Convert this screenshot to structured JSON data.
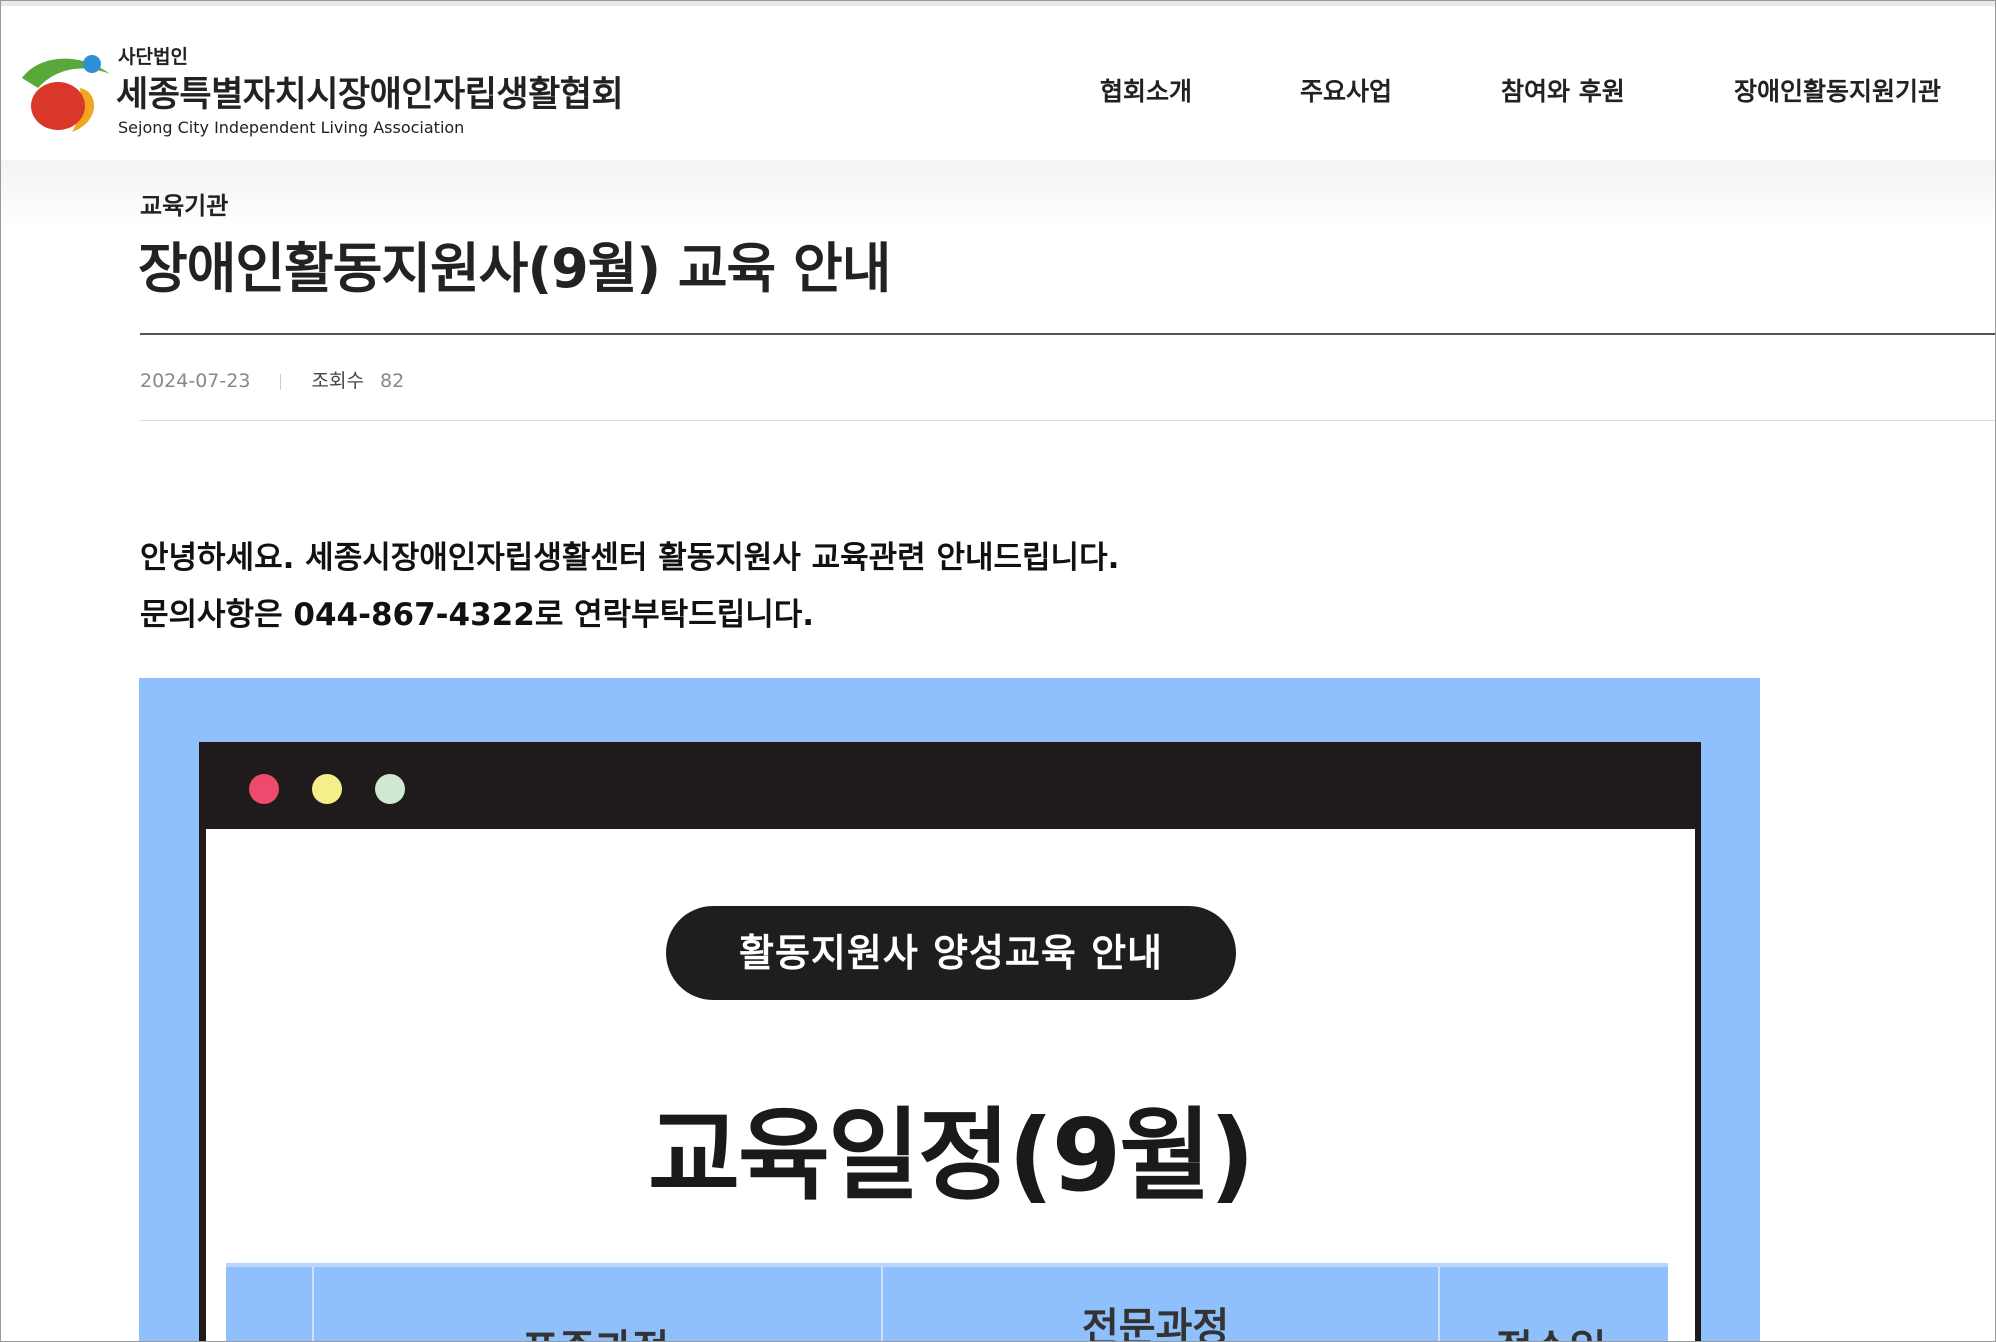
{
  "logo": {
    "subtitle": "사단법인",
    "name": "세종특별자치시장애인자립생활협회",
    "english_name": "Sejong City Independent Living Association"
  },
  "nav": {
    "items": [
      {
        "label": "협회소개"
      },
      {
        "label": "주요사업"
      },
      {
        "label": "참여와 후원"
      },
      {
        "label": "장애인활동지원기관"
      }
    ]
  },
  "post": {
    "category": "교육기관",
    "title": "장애인활동지원사(9월) 교육 안내",
    "date": "2024-07-23",
    "views_label": "조회수",
    "views": "82",
    "body_lines": [
      "안녕하세요. 세종시장애인자립생활센터 활동지원사 교육관련 안내드립니다.",
      "문의사항은 044-867-4322로 연락부탁드립니다."
    ]
  },
  "poster": {
    "pill_text": "활동지원사 양성교육 안내",
    "heading": "교육일정(9월)",
    "table_headers": [
      "표준과정",
      "전문과정",
      "접수일"
    ],
    "colors": {
      "background": "#90c0fc",
      "window": "#1f1b1c",
      "dot_red": "#ee4a6e",
      "dot_yellow": "#f5ee8a",
      "dot_green": "#cfe8d2"
    }
  }
}
